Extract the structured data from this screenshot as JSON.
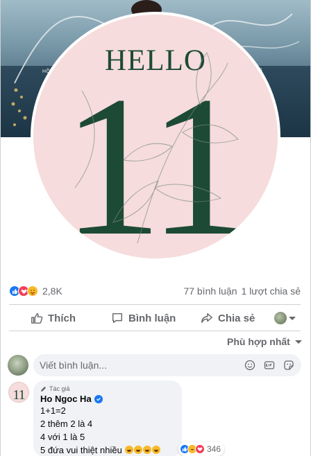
{
  "cover": {
    "text_left": "HỒ",
    "text_right": "S"
  },
  "avatar_artwork": {
    "headline": "HELLO",
    "number": "11"
  },
  "stats": {
    "reaction_count": "2,8K",
    "comments": "77 bình luận",
    "shares": "1 lượt chia sẻ"
  },
  "actions": {
    "like": "Thích",
    "comment": "Bình luận",
    "share": "Chia sẻ"
  },
  "sort": {
    "label": "Phù hợp nhất"
  },
  "composer": {
    "placeholder": "Viết bình luận..."
  },
  "comment": {
    "badge": "Tác giả",
    "author": "Ho Ngoc Ha",
    "avatar_text": "11",
    "lines": [
      "1+1=2",
      "2 thêm 2 là 4",
      "4 với 1 là 5",
      "5 đứa vui thiệt nhiều"
    ],
    "reaction_count": "346"
  },
  "colors": {
    "brand_blue": "#1877f2",
    "avatar_pink": "#f6dcdc",
    "artwork_green": "#1d4a35",
    "muted_text": "#65676b"
  },
  "icons": [
    "like-icon",
    "love-icon",
    "haha-icon",
    "comment-icon",
    "share-icon",
    "emoji-icon",
    "gif-icon",
    "sticker-icon",
    "verified-icon",
    "pen-icon"
  ]
}
